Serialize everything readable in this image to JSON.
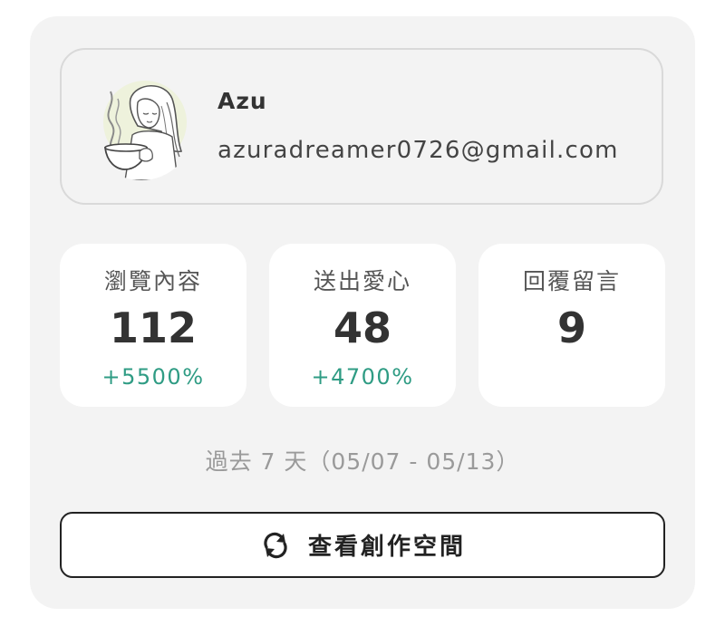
{
  "profile": {
    "name": "Azu",
    "email": "azuradreamer0726@gmail.com",
    "avatar_icon": "user-avatar-illustration"
  },
  "stats": [
    {
      "label": "瀏覽內容",
      "value": "112",
      "change": "+5500%"
    },
    {
      "label": "送出愛心",
      "value": "48",
      "change": "+4700%"
    },
    {
      "label": "回覆留言",
      "value": "9",
      "change": ""
    }
  ],
  "range_text": "過去 7 天（05/07 - 05/13）",
  "action": {
    "label": "查看創作空間",
    "icon": "refresh-icon"
  },
  "colors": {
    "card_bg": "#f3f3f3",
    "stat_bg": "#ffffff",
    "positive_change": "#2f9c84",
    "text_primary": "#333333",
    "text_muted": "#9a9a9a"
  }
}
